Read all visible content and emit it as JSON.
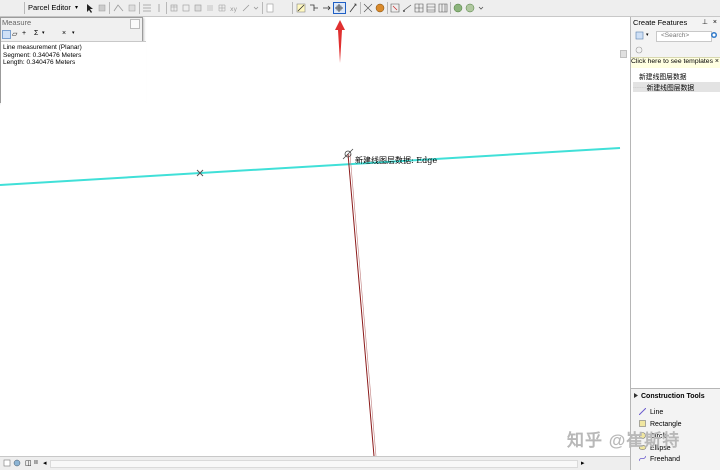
{
  "toolbar": {
    "parcel_editor_label": "Parcel Editor"
  },
  "measure": {
    "title": "Measure",
    "lines": [
      "Line measurement (Planar)",
      "Segment: 0.340476 Meters",
      "Length: 0.340476 Meters"
    ]
  },
  "map": {
    "edge_label": "新建线图层数据: Edge",
    "line_color": "#40e0d8",
    "sketch_color": "#8b1a1a",
    "arrow_color": "#e03030"
  },
  "create_features": {
    "title": "Create Features",
    "pin_icon": "pin-icon",
    "search_placeholder": "<Search>",
    "hint": "Click here to see templates",
    "layers": [
      "新建线图层数据",
      "新建线图层数据"
    ]
  },
  "construction_tools": {
    "title": "Construction Tools",
    "items": [
      "Line",
      "Rectangle",
      "Circle",
      "Ellipse",
      "Freehand"
    ]
  },
  "watermark": "知乎 @崔斯特"
}
